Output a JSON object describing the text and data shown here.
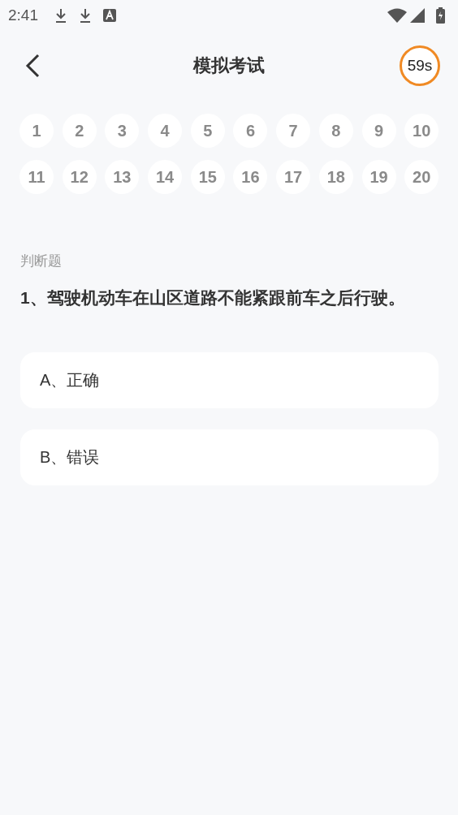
{
  "status_bar": {
    "time": "2:41"
  },
  "header": {
    "title": "模拟考试",
    "timer": "59s"
  },
  "question_numbers": [
    "1",
    "2",
    "3",
    "4",
    "5",
    "6",
    "7",
    "8",
    "9",
    "10",
    "11",
    "12",
    "13",
    "14",
    "15",
    "16",
    "17",
    "18",
    "19",
    "20"
  ],
  "question": {
    "type": "判断题",
    "text": "1、驾驶机动车在山区道路不能紧跟前车之后行驶。",
    "options": [
      {
        "label": "A、正确"
      },
      {
        "label": "B、错误"
      }
    ]
  }
}
